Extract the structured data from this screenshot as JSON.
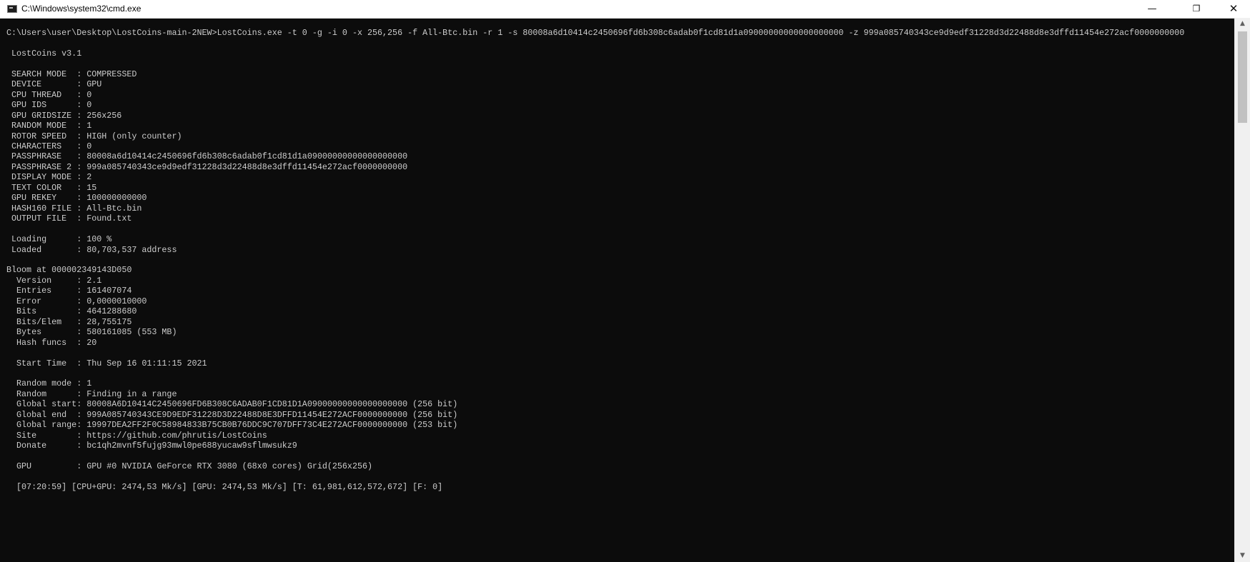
{
  "window": {
    "title": "C:\\Windows\\system32\\cmd.exe",
    "min_glyph": "—",
    "max_glyph": "❐",
    "close_glyph": "✕",
    "icon": "cmd-window-icon"
  },
  "colors": {
    "console_bg": "#0c0c0c",
    "console_text": "#cccccc",
    "titlebar_bg": "#ffffff"
  },
  "scrollbar": {
    "up_glyph": "▲",
    "down_glyph": "▼"
  },
  "console": {
    "lines": [
      "C:\\Users\\user\\Desktop\\LostCoins-main-2NEW>LostCoins.exe -t 0 -g -i 0 -x 256,256 -f All-Btc.bin -r 1 -s 80008a6d10414c2450696fd6b308c6adab0f1cd81d1a09000000000000000000 -z 999a085740343ce9d9edf31228d3d22488d8e3dffd11454e272acf0000000000",
      "",
      " LostCoins v3.1",
      "",
      " SEARCH MODE  : COMPRESSED",
      " DEVICE       : GPU",
      " CPU THREAD   : 0",
      " GPU IDS      : 0",
      " GPU GRIDSIZE : 256x256",
      " RANDOM MODE  : 1",
      " ROTOR SPEED  : HIGH (only counter)",
      " CHARACTERS   : 0",
      " PASSPHRASE   : 80008a6d10414c2450696fd6b308c6adab0f1cd81d1a09000000000000000000",
      " PASSPHRASE 2 : 999a085740343ce9d9edf31228d3d22488d8e3dffd11454e272acf0000000000",
      " DISPLAY MODE : 2",
      " TEXT COLOR   : 15",
      " GPU REKEY    : 100000000000",
      " HASH160 FILE : All-Btc.bin",
      " OUTPUT FILE  : Found.txt",
      "",
      " Loading      : 100 %",
      " Loaded       : 80,703,537 address",
      "",
      "Bloom at 000002349143D050",
      "  Version     : 2.1",
      "  Entries     : 161407074",
      "  Error       : 0,0000010000",
      "  Bits        : 4641288680",
      "  Bits/Elem   : 28,755175",
      "  Bytes       : 580161085 (553 MB)",
      "  Hash funcs  : 20",
      "",
      "  Start Time  : Thu Sep 16 01:11:15 2021",
      "",
      "  Random mode : 1",
      "  Random      : Finding in a range",
      "  Global start: 80008A6D10414C2450696FD6B308C6ADAB0F1CD81D1A09000000000000000000 (256 bit)",
      "  Global end  : 999A085740343CE9D9EDF31228D3D22488D8E3DFFD11454E272ACF0000000000 (256 bit)",
      "  Global range: 19997DEA2FF2F0C58984833B75CB0B76DDC9C707DFF73C4E272ACF0000000000 (253 bit)",
      "  Site        : https://github.com/phrutis/LostCoins",
      "  Donate      : bc1qh2mvnf5fujg93mwl0pe688yucaw9sflmwsukz9",
      "",
      "  GPU         : GPU #0 NVIDIA GeForce RTX 3080 (68x0 cores) Grid(256x256)",
      "",
      "  [07:20:59] [CPU+GPU: 2474,53 Mk/s] [GPU: 2474,53 Mk/s] [T: 61,981,612,572,672] [F: 0]"
    ]
  }
}
